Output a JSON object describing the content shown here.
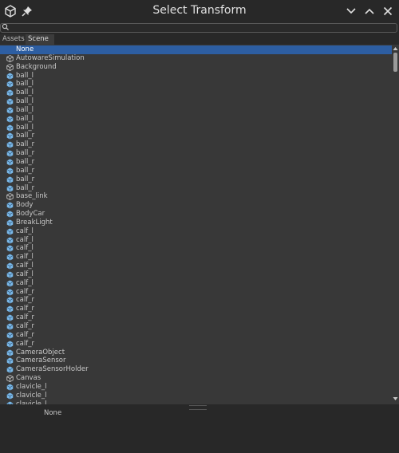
{
  "window": {
    "title": "Select Transform"
  },
  "search": {
    "value": ""
  },
  "tabs": [
    {
      "label": "Assets"
    },
    {
      "label": "Scene"
    }
  ],
  "list": {
    "items": [
      {
        "label": "None",
        "icon": "none",
        "selected": true
      },
      {
        "label": "AutowareSimulation",
        "icon": "gameobject-outline-icon"
      },
      {
        "label": "Background",
        "icon": "gameobject-outline-icon"
      },
      {
        "label": "ball_l",
        "icon": "prefab-cube-icon"
      },
      {
        "label": "ball_l",
        "icon": "prefab-cube-icon"
      },
      {
        "label": "ball_l",
        "icon": "prefab-cube-icon"
      },
      {
        "label": "ball_l",
        "icon": "prefab-cube-icon"
      },
      {
        "label": "ball_l",
        "icon": "prefab-cube-icon"
      },
      {
        "label": "ball_l",
        "icon": "prefab-cube-icon"
      },
      {
        "label": "ball_l",
        "icon": "prefab-cube-icon"
      },
      {
        "label": "ball_r",
        "icon": "prefab-cube-icon"
      },
      {
        "label": "ball_r",
        "icon": "prefab-cube-icon"
      },
      {
        "label": "ball_r",
        "icon": "prefab-cube-icon"
      },
      {
        "label": "ball_r",
        "icon": "prefab-cube-icon"
      },
      {
        "label": "ball_r",
        "icon": "prefab-cube-icon"
      },
      {
        "label": "ball_r",
        "icon": "prefab-cube-icon"
      },
      {
        "label": "ball_r",
        "icon": "prefab-cube-icon"
      },
      {
        "label": "base_link",
        "icon": "gameobject-outline-icon"
      },
      {
        "label": "Body",
        "icon": "prefab-cube-icon"
      },
      {
        "label": "BodyCar",
        "icon": "prefab-cube-icon"
      },
      {
        "label": "BreakLight",
        "icon": "prefab-cube-icon"
      },
      {
        "label": "calf_l",
        "icon": "prefab-cube-icon"
      },
      {
        "label": "calf_l",
        "icon": "prefab-cube-icon"
      },
      {
        "label": "calf_l",
        "icon": "prefab-cube-icon"
      },
      {
        "label": "calf_l",
        "icon": "prefab-cube-icon"
      },
      {
        "label": "calf_l",
        "icon": "prefab-cube-icon"
      },
      {
        "label": "calf_l",
        "icon": "prefab-cube-icon"
      },
      {
        "label": "calf_l",
        "icon": "prefab-cube-icon"
      },
      {
        "label": "calf_r",
        "icon": "prefab-cube-icon"
      },
      {
        "label": "calf_r",
        "icon": "prefab-cube-icon"
      },
      {
        "label": "calf_r",
        "icon": "prefab-cube-icon"
      },
      {
        "label": "calf_r",
        "icon": "prefab-cube-icon"
      },
      {
        "label": "calf_r",
        "icon": "prefab-cube-icon"
      },
      {
        "label": "calf_r",
        "icon": "prefab-cube-icon"
      },
      {
        "label": "calf_r",
        "icon": "prefab-cube-icon"
      },
      {
        "label": "CameraObject",
        "icon": "prefab-cube-icon"
      },
      {
        "label": "CameraSensor",
        "icon": "prefab-cube-icon"
      },
      {
        "label": "CameraSensorHolder",
        "icon": "prefab-cube-icon"
      },
      {
        "label": "Canvas",
        "icon": "gameobject-outline-icon"
      },
      {
        "label": "clavicle_l",
        "icon": "prefab-cube-icon"
      },
      {
        "label": "clavicle_l",
        "icon": "prefab-cube-icon"
      },
      {
        "label": "clavicle_l",
        "icon": "prefab-cube-icon"
      }
    ]
  },
  "preview": {
    "label": "None"
  },
  "colors": {
    "selection": "#2d5ea2",
    "prefab": "#7ab8e8",
    "background": "#383838",
    "titlebar": "#282828"
  }
}
